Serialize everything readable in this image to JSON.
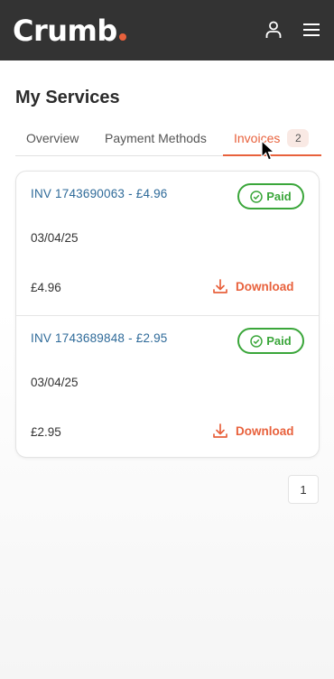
{
  "header": {
    "logo": "Crumb",
    "brand_color": "#e8613c",
    "icons": [
      "user-icon",
      "hamburger-menu-icon"
    ]
  },
  "page": {
    "title": "My Services"
  },
  "tabs": [
    {
      "label": "Overview",
      "active": false
    },
    {
      "label": "Payment Methods",
      "active": false
    },
    {
      "label": "Invoices",
      "active": true,
      "badge": "2"
    }
  ],
  "invoices": [
    {
      "title": "INV 1743690063 - £4.96",
      "status": "Paid",
      "date": "03/04/25",
      "amount": "£4.96",
      "action": "Download"
    },
    {
      "title": "INV 1743689848 - £2.95",
      "status": "Paid",
      "date": "03/04/25",
      "amount": "£2.95",
      "action": "Download"
    }
  ],
  "pagination": {
    "current": "1"
  },
  "colors": {
    "accent": "#e8613c",
    "paid": "#3aa63a",
    "link": "#2e6a99",
    "header_bg": "#333333"
  }
}
